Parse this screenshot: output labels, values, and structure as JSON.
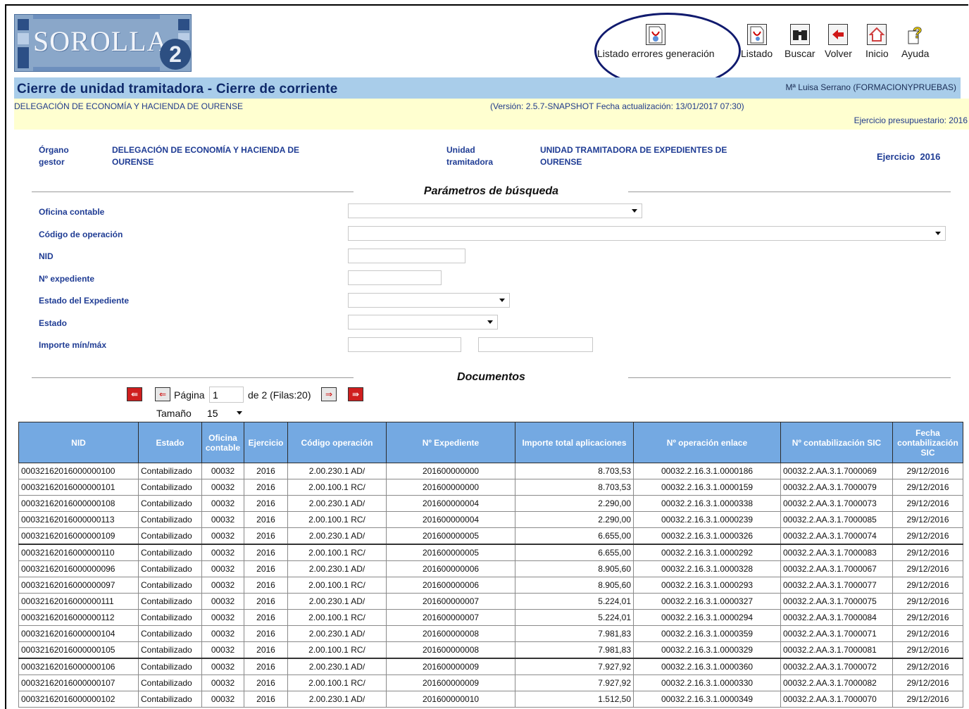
{
  "header": {
    "logo_text": "SOROLLA",
    "logo_number": "2",
    "toolbar": [
      {
        "label": "Listado errores generación",
        "icon": "pdf-error-report-icon"
      },
      {
        "label": "Listado",
        "icon": "pdf-report-icon"
      },
      {
        "label": "Buscar",
        "icon": "binoculars-icon"
      },
      {
        "label": "Volver",
        "icon": "back-arrow-icon"
      },
      {
        "label": "Inicio",
        "icon": "home-icon"
      },
      {
        "label": "Ayuda",
        "icon": "help-icon"
      }
    ],
    "page_title": "Cierre de unidad tramitadora - Cierre de corriente",
    "user": "Mª Luisa Serrano (FORMACIONYPRUEBAS)",
    "delegation": "DELEGACIÓN DE ECONOMÍA Y HACIENDA DE OURENSE",
    "version": "(Versión: 2.5.7-SNAPSHOT Fecha actualización: 13/01/2017 07:30)",
    "fiscal_year": "Ejercicio presupuestario: 2016",
    "colors": {
      "title_bar": "#a9cdea",
      "info_bar": "#ffffd0",
      "table_header": "#74a9e2",
      "callout": "#101a6e"
    }
  },
  "org": {
    "organo_label_1": "Órgano",
    "organo_label_2": "gestor",
    "organo_value_1": "DELEGACIÓN DE ECONOMÍA Y HACIENDA DE",
    "organo_value_2": "OURENSE",
    "unidad_label_1": "Unidad",
    "unidad_label_2": "tramitadora",
    "unidad_value_1": "UNIDAD TRAMITADORA DE EXPEDIENTES DE",
    "unidad_value_2": "OURENSE",
    "ejercicio_label": "Ejercicio",
    "ejercicio_value": "2016"
  },
  "search": {
    "title": "Parámetros de búsqueda",
    "oficina_contable": "Oficina contable",
    "codigo_operacion": "Código de operación",
    "nid": "NID",
    "n_expediente": "Nº expediente",
    "estado_expediente": "Estado del Expediente",
    "estado": "Estado",
    "importe": "Importe mín/máx"
  },
  "documents": {
    "title": "Documentos",
    "page_label": "Página",
    "page_value": "1",
    "page_of": "de 2 (Filas:20)",
    "size_label": "Tamaño",
    "size_value": "15",
    "columns": [
      "NID",
      "Estado",
      "Oficina contable",
      "Ejercicio",
      "Código operación",
      "Nº Expediente",
      "Importe total aplicaciones",
      "Nº operación enlace",
      "Nº contabilización SIC",
      "Fecha contabilización SIC"
    ],
    "rows": [
      [
        "00032162016000000100",
        "Contabilizado",
        "00032",
        "2016",
        "2.00.230.1 AD/",
        "201600000000",
        "8.703,53",
        "00032.2.16.3.1.0000186",
        "00032.2.AA.3.1.7000069",
        "29/12/2016"
      ],
      [
        "00032162016000000101",
        "Contabilizado",
        "00032",
        "2016",
        "2.00.100.1 RC/",
        "201600000000",
        "8.703,53",
        "00032.2.16.3.1.0000159",
        "00032.2.AA.3.1.7000079",
        "29/12/2016"
      ],
      [
        "00032162016000000108",
        "Contabilizado",
        "00032",
        "2016",
        "2.00.230.1 AD/",
        "201600000004",
        "2.290,00",
        "00032.2.16.3.1.0000338",
        "00032.2.AA.3.1.7000073",
        "29/12/2016"
      ],
      [
        "00032162016000000113",
        "Contabilizado",
        "00032",
        "2016",
        "2.00.100.1 RC/",
        "201600000004",
        "2.290,00",
        "00032.2.16.3.1.0000239",
        "00032.2.AA.3.1.7000085",
        "29/12/2016"
      ],
      [
        "00032162016000000109",
        "Contabilizado",
        "00032",
        "2016",
        "2.00.230.1 AD/",
        "201600000005",
        "6.655,00",
        "00032.2.16.3.1.0000326",
        "00032.2.AA.3.1.7000074",
        "29/12/2016"
      ],
      [
        "00032162016000000110",
        "Contabilizado",
        "00032",
        "2016",
        "2.00.100.1 RC/",
        "201600000005",
        "6.655,00",
        "00032.2.16.3.1.0000292",
        "00032.2.AA.3.1.7000083",
        "29/12/2016"
      ],
      [
        "00032162016000000096",
        "Contabilizado",
        "00032",
        "2016",
        "2.00.230.1 AD/",
        "201600000006",
        "8.905,60",
        "00032.2.16.3.1.0000328",
        "00032.2.AA.3.1.7000067",
        "29/12/2016"
      ],
      [
        "00032162016000000097",
        "Contabilizado",
        "00032",
        "2016",
        "2.00.100.1 RC/",
        "201600000006",
        "8.905,60",
        "00032.2.16.3.1.0000293",
        "00032.2.AA.3.1.7000077",
        "29/12/2016"
      ],
      [
        "00032162016000000111",
        "Contabilizado",
        "00032",
        "2016",
        "2.00.230.1 AD/",
        "201600000007",
        "5.224,01",
        "00032.2.16.3.1.0000327",
        "00032.2.AA.3.1.7000075",
        "29/12/2016"
      ],
      [
        "00032162016000000112",
        "Contabilizado",
        "00032",
        "2016",
        "2.00.100.1 RC/",
        "201600000007",
        "5.224,01",
        "00032.2.16.3.1.0000294",
        "00032.2.AA.3.1.7000084",
        "29/12/2016"
      ],
      [
        "00032162016000000104",
        "Contabilizado",
        "00032",
        "2016",
        "2.00.230.1 AD/",
        "201600000008",
        "7.981,83",
        "00032.2.16.3.1.0000359",
        "00032.2.AA.3.1.7000071",
        "29/12/2016"
      ],
      [
        "00032162016000000105",
        "Contabilizado",
        "00032",
        "2016",
        "2.00.100.1 RC/",
        "201600000008",
        "7.981,83",
        "00032.2.16.3.1.0000329",
        "00032.2.AA.3.1.7000081",
        "29/12/2016"
      ],
      [
        "00032162016000000106",
        "Contabilizado",
        "00032",
        "2016",
        "2.00.230.1 AD/",
        "201600000009",
        "7.927,92",
        "00032.2.16.3.1.0000360",
        "00032.2.AA.3.1.7000072",
        "29/12/2016"
      ],
      [
        "00032162016000000107",
        "Contabilizado",
        "00032",
        "2016",
        "2.00.100.1 RC/",
        "201600000009",
        "7.927,92",
        "00032.2.16.3.1.0000330",
        "00032.2.AA.3.1.7000082",
        "29/12/2016"
      ],
      [
        "00032162016000000102",
        "Contabilizado",
        "00032",
        "2016",
        "2.00.230.1 AD/",
        "201600000010",
        "1.512,50",
        "00032.2.16.3.1.0000349",
        "00032.2.AA.3.1.7000070",
        "29/12/2016"
      ]
    ]
  }
}
